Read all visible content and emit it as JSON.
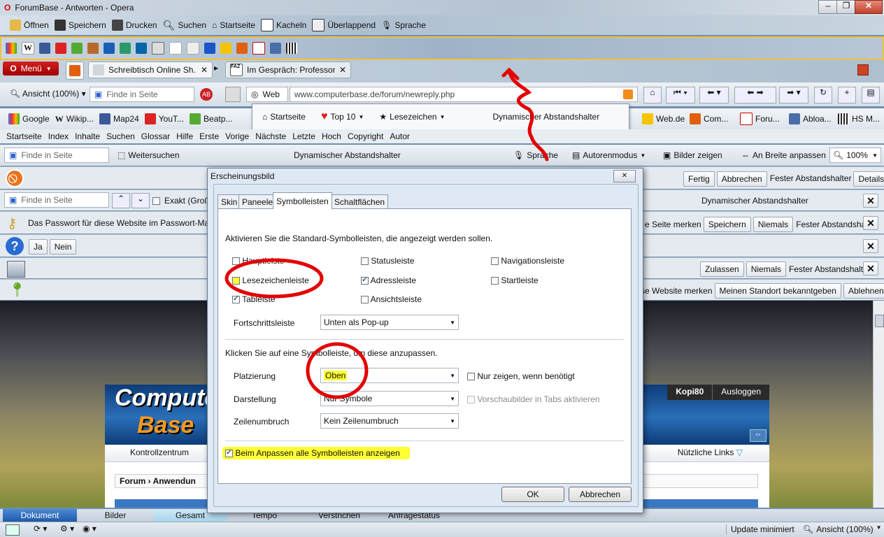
{
  "window": {
    "title": "ForumBase - Antworten - Opera"
  },
  "main_toolbar": [
    "Öffnen",
    "Speichern",
    "Drucken",
    "Suchen",
    "Startseite",
    "Kacheln",
    "Überlappend",
    "Sprache"
  ],
  "menu_button": "Menü",
  "tabs": [
    "Schreibtisch Online Sh...",
    "Im Gespräch: Professor..."
  ],
  "address_bar": {
    "view_label": "Ansicht (100%)",
    "find_placeholder": "Finde in Seite",
    "web_label": "Web",
    "url": "www.computerbase.de/forum/newreply.php"
  },
  "speed_popup": {
    "items": [
      "Startseite",
      "Top 10",
      "Lesezeichen"
    ],
    "dynamic": "Dynamischer Abstandshalter"
  },
  "bookmarks": [
    "Google",
    "Wikip...",
    "Map24",
    "YouT...",
    "Beatp...",
    "Web.de",
    "Com...",
    "Foru...",
    "Abloa...",
    "HS M..."
  ],
  "nav_links": [
    "Startseite",
    "Index",
    "Inhalte",
    "Suchen",
    "Glossar",
    "Hilfe",
    "Erste",
    "Vorige",
    "Nächste",
    "Letzte",
    "Hoch",
    "Copyright",
    "Autor"
  ],
  "find_bar": {
    "placeholder": "Finde in Seite",
    "continue": "Weitersuchen",
    "dynamic": "Dynamischer Abstandshalter",
    "voice": "Sprache",
    "author": "Autorenmodus",
    "images": "Bilder zeigen",
    "fit": "An Breite anpassen",
    "zoom": "100%"
  },
  "bar_edit": {
    "done": "Fertig",
    "cancel": "Abbrechen",
    "fixed": "Fester Abstandshalter",
    "details": "Details..."
  },
  "bar_find2": {
    "placeholder": "Finde in Seite",
    "exact": "Exakt (Groß",
    "dynamic": "Dynamischer Abstandshalter"
  },
  "bar_password": {
    "text": "Das Passwort für diese Website im Passwort-Mar",
    "remember_suffix": "e Seite merken",
    "save": "Speichern",
    "never": "Niemals",
    "fixed": "Fester Abstandshalter"
  },
  "bar_question": {
    "yes": "Ja",
    "no": "Nein"
  },
  "bar_storage": {
    "allow": "Zulassen",
    "never": "Niemals",
    "fixed": "Fester Abstandshalter"
  },
  "bar_geo": {
    "prefix": "se Website merken",
    "share": "Meinen Standort bekanntgeben",
    "deny": "Ablehnen"
  },
  "page": {
    "user": "Kopi80",
    "logout": "Ausloggen",
    "nav_left": "Kontrollzentrum",
    "nav_right": "Nützliche Links",
    "breadcrumb_1": "Forum",
    "breadcrumb_2": "Anwendun",
    "logo_1": "Computer",
    "logo_2": "Base"
  },
  "dialog": {
    "title": "Erscheinungsbild",
    "tabs": [
      "Skin",
      "Paneele",
      "Symbolleisten",
      "Schaltflächen"
    ],
    "intro": "Aktivieren Sie die Standard-Symbolleisten, die angezeigt werden sollen.",
    "checks": [
      {
        "label": "Hauptleiste",
        "checked": false
      },
      {
        "label": "Statusleiste",
        "checked": false
      },
      {
        "label": "Navigationsleiste",
        "checked": false
      },
      {
        "label": "Lesezeichenleiste",
        "checked": false
      },
      {
        "label": "Adressleiste",
        "checked": true
      },
      {
        "label": "Startleiste",
        "checked": false
      },
      {
        "label": "Tableiste",
        "checked": true
      },
      {
        "label": "Ansichtsleiste",
        "checked": false
      }
    ],
    "progress_label": "Fortschrittsleiste",
    "progress_value": "Unten als Pop-up",
    "customize_intro": "Klicken Sie auf eine Symbolleiste, um diese anzupassen.",
    "placement_label": "Platzierung",
    "placement_value": "Oben",
    "display_label": "Darstellung",
    "display_value": "Nur Symbole",
    "wrap_label": "Zeilenumbruch",
    "wrap_value": "Kein Zeilenumbruch",
    "only_when_needed": "Nur zeigen, wenn benötigt",
    "tab_thumbs": "Vorschaubilder in Tabs aktivieren",
    "show_all": "Beim Anpassen alle Symbolleisten anzeigen",
    "ok": "OK",
    "cancel": "Abbrechen"
  },
  "bottom_tabs": [
    "Dokument",
    "Bilder",
    "Gesamt",
    "Tempo",
    "Verstrichen",
    "Anfragestatus"
  ],
  "status": {
    "update": "Update minimiert",
    "view": "Ansicht (100%)"
  }
}
